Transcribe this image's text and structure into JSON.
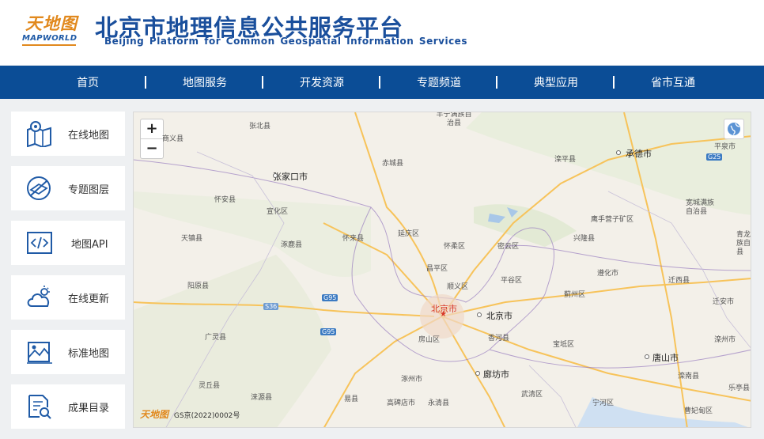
{
  "header": {
    "logo_cn": "天地图",
    "logo_en": "MAPWORLD",
    "title": "北京市地理信息公共服务平台",
    "subtitle": "Beijing Platform for Common Geospatial Information Services"
  },
  "nav": {
    "items": [
      {
        "label": "首页"
      },
      {
        "label": "地图服务"
      },
      {
        "label": "开发资源"
      },
      {
        "label": "专题频道"
      },
      {
        "label": "典型应用"
      },
      {
        "label": "省市互通"
      }
    ]
  },
  "sidebar": {
    "items": [
      {
        "label": "在线地图",
        "icon": "map-pin-icon"
      },
      {
        "label": "专题图层",
        "icon": "layer-slash-icon"
      },
      {
        "label": "地图API",
        "icon": "code-icon"
      },
      {
        "label": "在线更新",
        "icon": "cloud-update-icon"
      },
      {
        "label": "标准地图",
        "icon": "standard-map-icon"
      },
      {
        "label": "成果目录",
        "icon": "catalog-icon"
      }
    ]
  },
  "map": {
    "zoom_in": "+",
    "zoom_out": "−",
    "attribution_logo": "天地图",
    "attribution": "GS京(2022)0002号",
    "labels": [
      {
        "text": "张北县"
      },
      {
        "text": "丰宁满族自治县"
      },
      {
        "text": "商义县"
      },
      {
        "text": "张家口市"
      },
      {
        "text": "赤城县"
      },
      {
        "text": "滦平县"
      },
      {
        "text": "承德市"
      },
      {
        "text": "平泉市"
      },
      {
        "text": "怀安县"
      },
      {
        "text": "宣化区"
      },
      {
        "text": "宽城满族自治县"
      },
      {
        "text": "鹰手营子矿区"
      },
      {
        "text": "天镇县"
      },
      {
        "text": "涿鹿县"
      },
      {
        "text": "怀来县"
      },
      {
        "text": "延庆区"
      },
      {
        "text": "怀柔区"
      },
      {
        "text": "密云区"
      },
      {
        "text": "兴隆县"
      },
      {
        "text": "青龙满族自治县"
      },
      {
        "text": "昌平区"
      },
      {
        "text": "遵化市"
      },
      {
        "text": "迁西县"
      },
      {
        "text": "阳原县"
      },
      {
        "text": "顺义区"
      },
      {
        "text": "平谷区"
      },
      {
        "text": "蓟州区"
      },
      {
        "text": "迁安市"
      },
      {
        "text": "北京市"
      },
      {
        "text": "广灵县"
      },
      {
        "text": "房山区"
      },
      {
        "text": "香河县"
      },
      {
        "text": "宝坻区"
      },
      {
        "text": "滦州市"
      },
      {
        "text": "唐山市"
      },
      {
        "text": "涿州市"
      },
      {
        "text": "廊坊市"
      },
      {
        "text": "灵丘县"
      },
      {
        "text": "涞源县"
      },
      {
        "text": "易县"
      },
      {
        "text": "高碑店市"
      },
      {
        "text": "永清县"
      },
      {
        "text": "武清区"
      },
      {
        "text": "滦南县"
      },
      {
        "text": "乐亭县"
      },
      {
        "text": "宁河区"
      },
      {
        "text": "曹妃甸区"
      }
    ],
    "shields": [
      "G25",
      "S36",
      "G95",
      "G95"
    ],
    "colors": {
      "water": "#a8c7e8",
      "green": "#dfe9cf",
      "road_major": "#f7c35a",
      "border": "#9a7fc0"
    }
  }
}
